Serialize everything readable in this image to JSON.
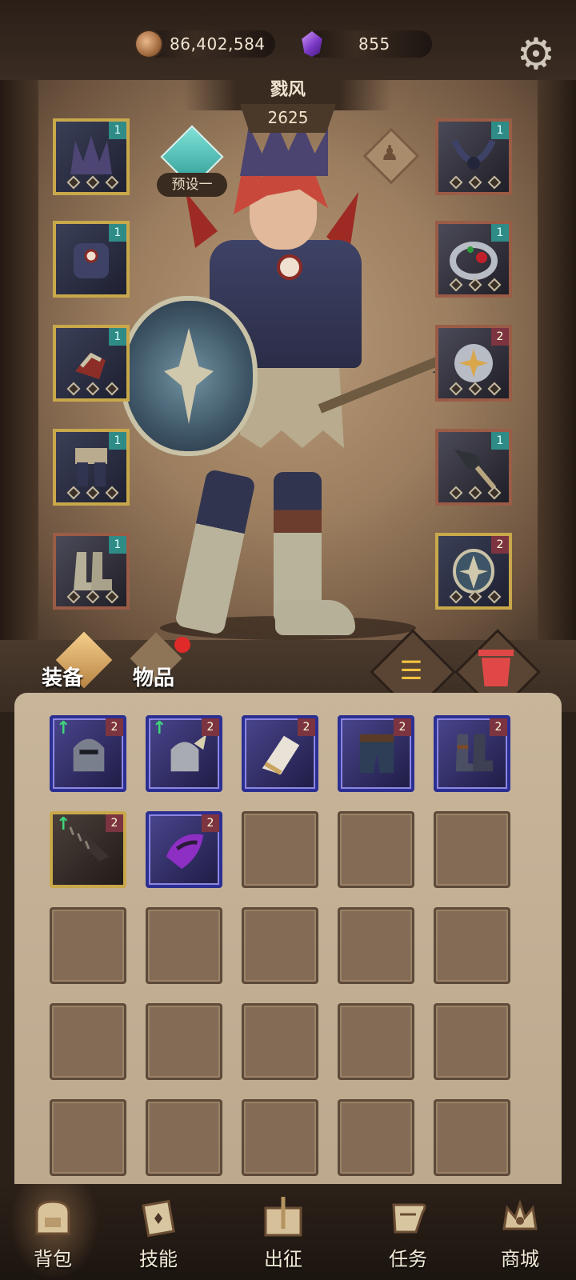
{
  "currency": {
    "gold": "86,402,584",
    "gems": "855",
    "gold_icon": "coin-icon",
    "gem_icon": "purple-crystal-icon"
  },
  "hero": {
    "name": "戮风",
    "power": "2625",
    "preset_label": "预设一"
  },
  "equipment_slots": {
    "left": [
      {
        "icon": "crown-helmet-icon",
        "tag": "1"
      },
      {
        "icon": "chest-armor-icon",
        "tag": "1"
      },
      {
        "icon": "gauntlet-icon",
        "tag": "1"
      },
      {
        "icon": "leg-armor-icon",
        "tag": "1"
      },
      {
        "icon": "boots-icon",
        "tag": "1"
      }
    ],
    "right": [
      {
        "icon": "necklace-icon",
        "tag": "1"
      },
      {
        "icon": "ring-icon",
        "tag": "1"
      },
      {
        "icon": "amulet-icon",
        "tag": "2"
      },
      {
        "icon": "spear-icon",
        "tag": "1"
      },
      {
        "icon": "shield-icon",
        "tag": "2"
      }
    ]
  },
  "tabs": {
    "equipment": "装备",
    "items": "物品"
  },
  "inventory": {
    "items": [
      {
        "icon": "helmet-icon",
        "level": "2",
        "upgrade": "↑"
      },
      {
        "icon": "winged-helmet-icon",
        "level": "2",
        "upgrade": "↑"
      },
      {
        "icon": "bracer-icon",
        "level": "2",
        "upgrade": ""
      },
      {
        "icon": "pants-icon",
        "level": "2",
        "upgrade": ""
      },
      {
        "icon": "greaves-icon",
        "level": "2",
        "upgrade": ""
      },
      {
        "icon": "spiked-club-icon",
        "level": "2",
        "upgrade": "↑"
      },
      {
        "icon": "purple-claw-icon",
        "level": "2",
        "upgrade": ""
      }
    ]
  },
  "nav": {
    "backpack": "背包",
    "skills": "技能",
    "battle": "出征",
    "quests": "任务",
    "shop": "商城"
  },
  "colors": {
    "gold_frame": "#c9a84b",
    "rare_frame": "#2c2f92",
    "teal_tag": "#2f8b86",
    "level_tag": "#7c3440"
  }
}
